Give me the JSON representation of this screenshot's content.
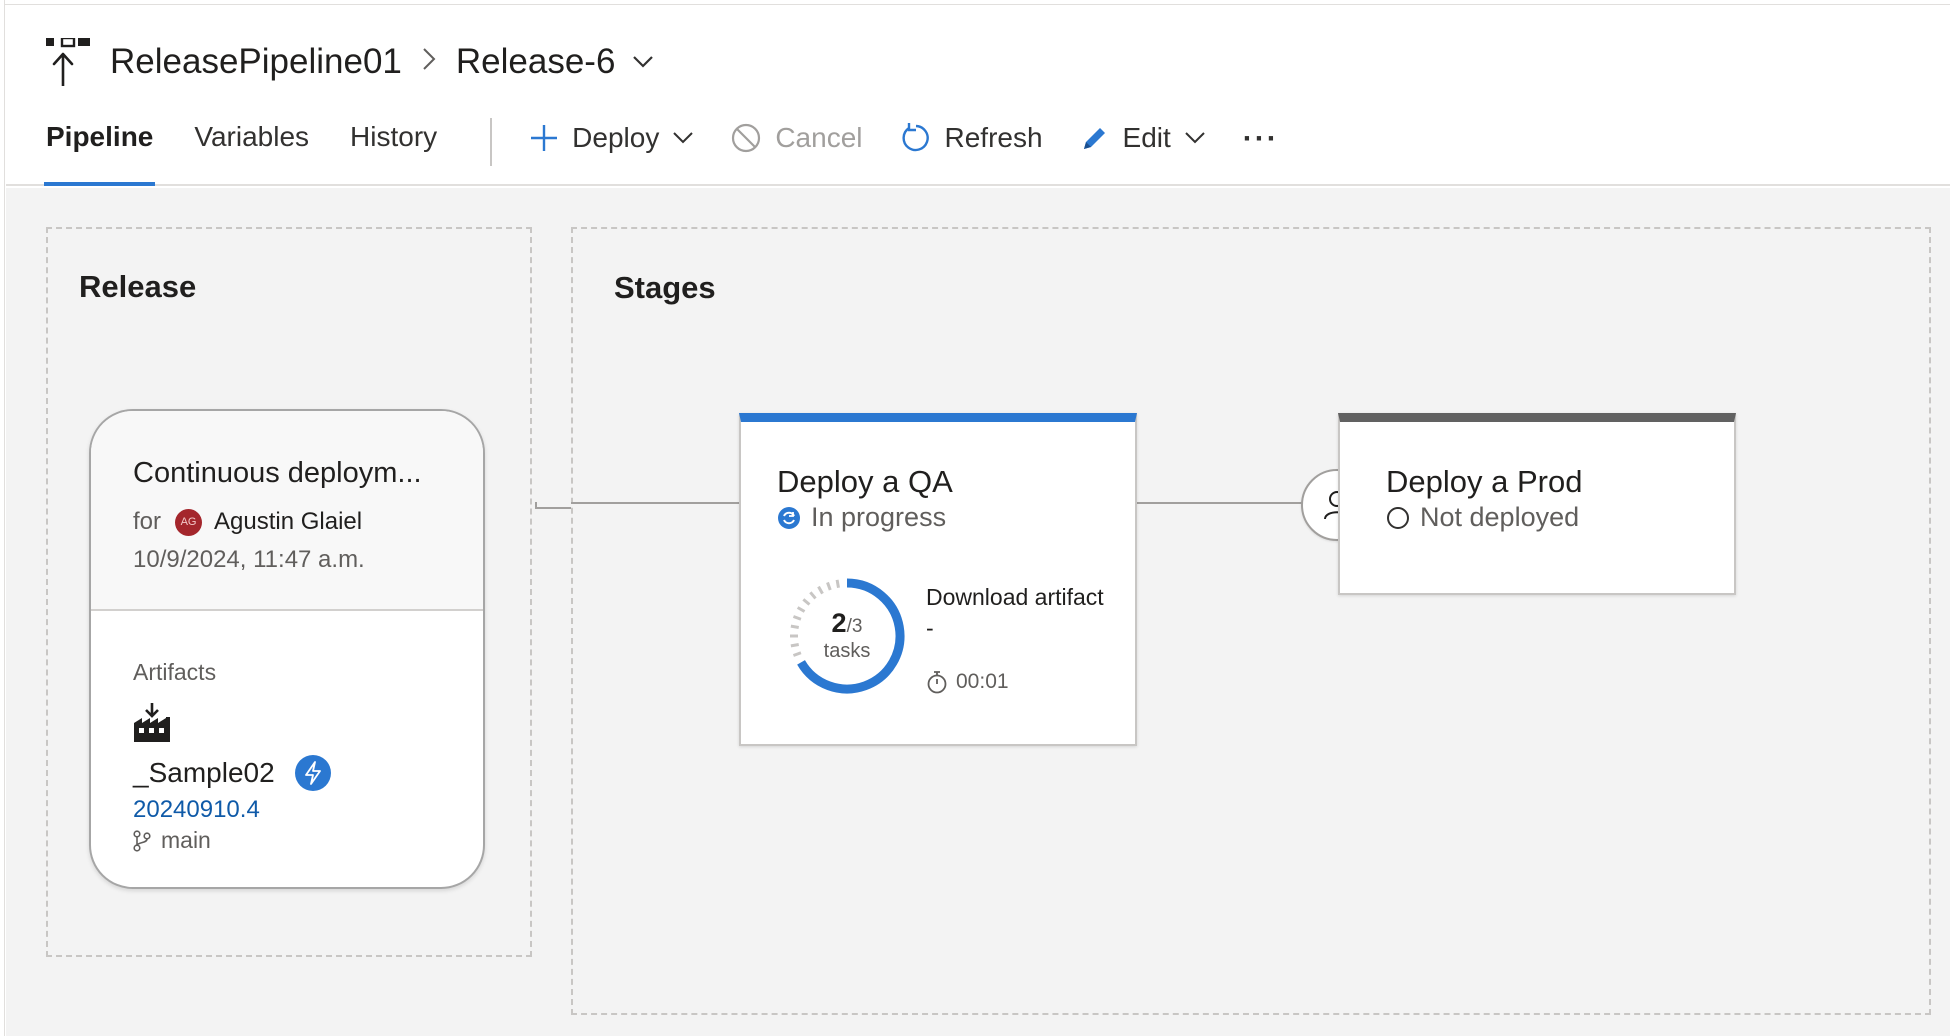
{
  "breadcrumb": {
    "pipeline": "ReleasePipeline01",
    "release": "Release-6"
  },
  "tabs": [
    {
      "label": "Pipeline",
      "active": true
    },
    {
      "label": "Variables",
      "active": false
    },
    {
      "label": "History",
      "active": false
    }
  ],
  "commands": {
    "deploy": "Deploy",
    "cancel": "Cancel",
    "refresh": "Refresh",
    "edit": "Edit",
    "more": "···"
  },
  "release_panel": {
    "title": "Release",
    "trigger": "Continuous deploym...",
    "for_label": "for",
    "avatar_initials": "AG",
    "author": "Agustin Glaiel",
    "date": "10/9/2024, 11:47 a.m.",
    "artifacts_label": "Artifacts",
    "artifact_name": "_Sample02",
    "build": "20240910.4",
    "branch": "main"
  },
  "stages_panel": {
    "title": "Stages",
    "stages": [
      {
        "name": "Deploy a QA",
        "status": "In progress",
        "tasks_done": "2",
        "tasks_total": "/3",
        "tasks_label": "tasks",
        "progress_fraction": 0.667,
        "current_task": "Download artifact -",
        "elapsed": "00:01"
      },
      {
        "name": "Deploy a Prod",
        "status": "Not deployed"
      }
    ]
  },
  "colors": {
    "accent": "#2b78d1",
    "link": "#0f5aa8",
    "not_deployed_bar": "#616161",
    "avatar": "#a4262c"
  },
  "icons": {
    "pipeline": "release-pipeline-icon",
    "deploy": "plus-icon",
    "cancel": "cancel-circle-icon",
    "refresh": "refresh-icon",
    "edit": "pencil-icon",
    "artifact": "build-artifact-icon",
    "trigger": "lightning-bolt-icon",
    "branch": "branch-icon",
    "approver": "person-icon",
    "timer": "stopwatch-icon"
  }
}
